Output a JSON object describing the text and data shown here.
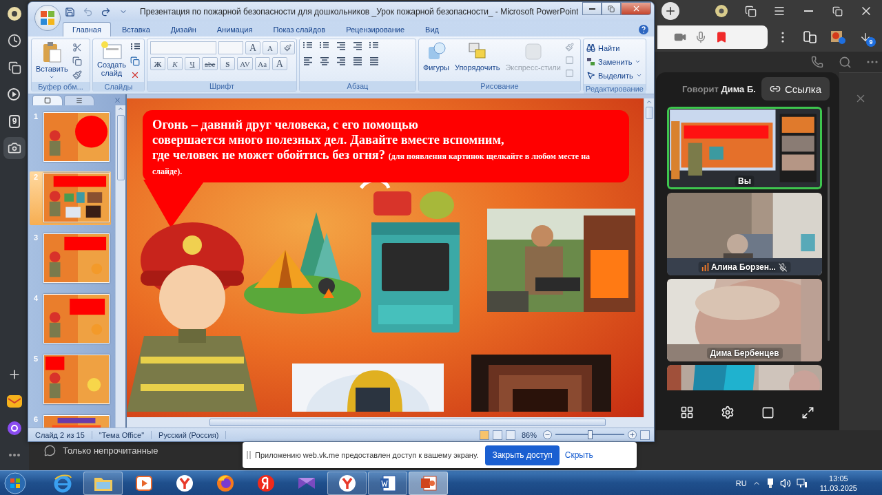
{
  "browser": {
    "sidebar_top": [
      {
        "kind": "ball",
        "selected": false
      },
      {
        "kind": "clock",
        "selected": false
      },
      {
        "kind": "collections",
        "selected": false
      },
      {
        "kind": "video",
        "selected": false
      },
      {
        "kind": "counter",
        "label": "9",
        "selected": false
      },
      {
        "kind": "screenshot",
        "selected": true
      }
    ],
    "sidebar_bottom": [
      {
        "kind": "add"
      },
      {
        "kind": "mail"
      },
      {
        "kind": "alice"
      },
      {
        "kind": "more"
      }
    ],
    "download_badge": "9",
    "filter_label": "Только непрочитанные"
  },
  "powerpoint": {
    "title": "Презентация по пожарной безопасности для дошкольников _Урок пожарной безопасности_ - Microsoft PowerPoint",
    "tabs": [
      {
        "label": "Главная",
        "selected": true
      },
      {
        "label": "Вставка",
        "selected": false
      },
      {
        "label": "Дизайн",
        "selected": false
      },
      {
        "label": "Анимация",
        "selected": false
      },
      {
        "label": "Показ слайдов",
        "selected": false
      },
      {
        "label": "Рецензирование",
        "selected": false
      },
      {
        "label": "Вид",
        "selected": false
      }
    ],
    "ribbon": {
      "clipboard": {
        "label": "Буфер обм...",
        "paste": "Вставить"
      },
      "slides": {
        "label": "Слайды",
        "new_slide": "Создать слайд"
      },
      "font": {
        "label": "Шрифт",
        "size_buttons": [
          "A",
          "A"
        ],
        "style_buttons": [
          "Ж",
          "К",
          "Ч",
          "abe",
          "S",
          "AV",
          "Aa"
        ],
        "color_button": "A"
      },
      "paragraph": {
        "label": "Абзац"
      },
      "drawing": {
        "label": "Рисование",
        "buttons": [
          {
            "label": "Фигуры",
            "disabled": false
          },
          {
            "label": "Упорядочить",
            "disabled": false
          },
          {
            "label": "Экспресс-стили",
            "disabled": true
          }
        ]
      },
      "editing": {
        "label": "Редактирование",
        "buttons": [
          {
            "label": "Найти",
            "dropdown": false
          },
          {
            "label": "Заменить",
            "dropdown": true
          },
          {
            "label": "Выделить",
            "dropdown": true
          }
        ]
      }
    },
    "slides": [
      {
        "number": "1",
        "selected": false
      },
      {
        "number": "2",
        "selected": true
      },
      {
        "number": "3",
        "selected": false
      },
      {
        "number": "4",
        "selected": false
      },
      {
        "number": "5",
        "selected": false
      },
      {
        "number": "6",
        "selected": false
      }
    ],
    "slide": {
      "lines": [
        "Огонь – давний друг человека, с его помощью",
        "совершается много полезных дел.  Давайте вместе вспомним,",
        "где человек не может обойтись без огня?"
      ],
      "hint": "(для появления картинок щелкайте в любом месте на слайде)."
    },
    "status_bar": {
      "slide": "Слайд 2 из 15",
      "theme": "\"Тема Office\"",
      "language": "Русский (Россия)",
      "zoom": "86%",
      "zoom_slider": {
        "level": 0.5
      }
    }
  },
  "call_panel": {
    "speaking_prefix": "Говорит",
    "speaker": "Дима Б.",
    "link_button": "Ссылка",
    "tiles": [
      {
        "kind": "screen",
        "name": "Вы",
        "highlighted": true,
        "muted": false,
        "speaking": false
      },
      {
        "kind": "room",
        "name": "Алина Борзен...",
        "highlighted": false,
        "muted": true,
        "speaking": true
      },
      {
        "kind": "closeup",
        "name": "Дима Бербенцев",
        "highlighted": false,
        "muted": false,
        "speaking": false
      },
      {
        "kind": "blue",
        "highlighted": false
      }
    ]
  },
  "notification": {
    "message": "Приложению web.vk.me предоставлен доступ к вашему экрану.",
    "primary_button": "Закрыть доступ",
    "secondary_button": "Скрыть"
  },
  "taskbar": {
    "apps": [
      {
        "kind": "ie",
        "running": false,
        "active": false
      },
      {
        "kind": "explorer",
        "running": true,
        "active": false
      },
      {
        "kind": "media",
        "running": false,
        "active": false
      },
      {
        "kind": "yandex",
        "running": false,
        "active": false
      },
      {
        "kind": "firefox",
        "running": false,
        "active": false
      },
      {
        "kind": "ya",
        "running": false,
        "active": false
      },
      {
        "kind": "studio",
        "running": false,
        "active": false
      },
      {
        "kind": "yandex",
        "running": true,
        "active": false
      },
      {
        "kind": "word",
        "running": true,
        "active": false
      },
      {
        "kind": "powerpoint",
        "running": true,
        "active": true
      }
    ],
    "language": "RU",
    "time": "13:05",
    "date": "11.03.2025"
  }
}
